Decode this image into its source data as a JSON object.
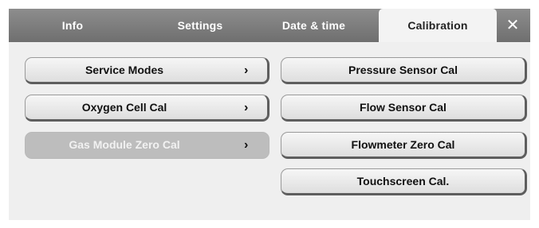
{
  "tabs": [
    {
      "label": "Info"
    },
    {
      "label": "Settings"
    },
    {
      "label": "Date & time"
    },
    {
      "label": "Calibration"
    }
  ],
  "close_label": "✕",
  "chevron_glyph": "›",
  "left_buttons": [
    {
      "label": "Service Modes",
      "enabled": true
    },
    {
      "label": "Oxygen Cell Cal",
      "enabled": true
    },
    {
      "label": "Gas Module Zero Cal",
      "enabled": false
    }
  ],
  "right_buttons": [
    {
      "label": "Pressure Sensor Cal"
    },
    {
      "label": "Flow Sensor Cal"
    },
    {
      "label": "Flowmeter Zero Cal"
    },
    {
      "label": "Touchscreen Cal."
    }
  ],
  "colors": {
    "tabbar": "#7b7b7b",
    "panel": "#efefef",
    "disabled_button": "#bdbdbd"
  }
}
